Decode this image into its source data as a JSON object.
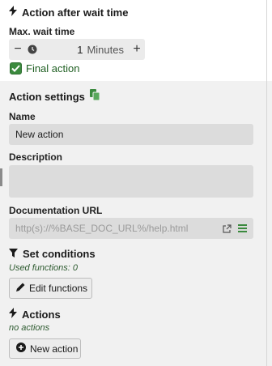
{
  "wait_section": {
    "title": "Action after wait time",
    "title_icon": "lightning-icon",
    "max_wait_label": "Max. wait time",
    "stepper": {
      "minus": "−",
      "value": "1",
      "unit": "Minutes",
      "plus": "+"
    },
    "final_action": {
      "label": "Final action",
      "checked": true
    }
  },
  "settings_section": {
    "title": "Action settings",
    "name_label": "Name",
    "name_value": "New action",
    "description_label": "Description",
    "description_value": "",
    "doc_url_label": "Documentation URL",
    "doc_url_placeholder": "http(s)://%BASE_DOC_URL%/help.html"
  },
  "conditions_section": {
    "title": "Set conditions",
    "used_functions": "Used functions: 0",
    "edit_button": "Edit functions"
  },
  "actions_section": {
    "title": "Actions",
    "empty_text": "no actions",
    "new_button": "New action"
  },
  "colors": {
    "accent_green": "#3b8a3e",
    "text_dark": "#1a1a1a",
    "input_bg": "#dcdcdc",
    "panel_bg": "#f1f1f1"
  }
}
